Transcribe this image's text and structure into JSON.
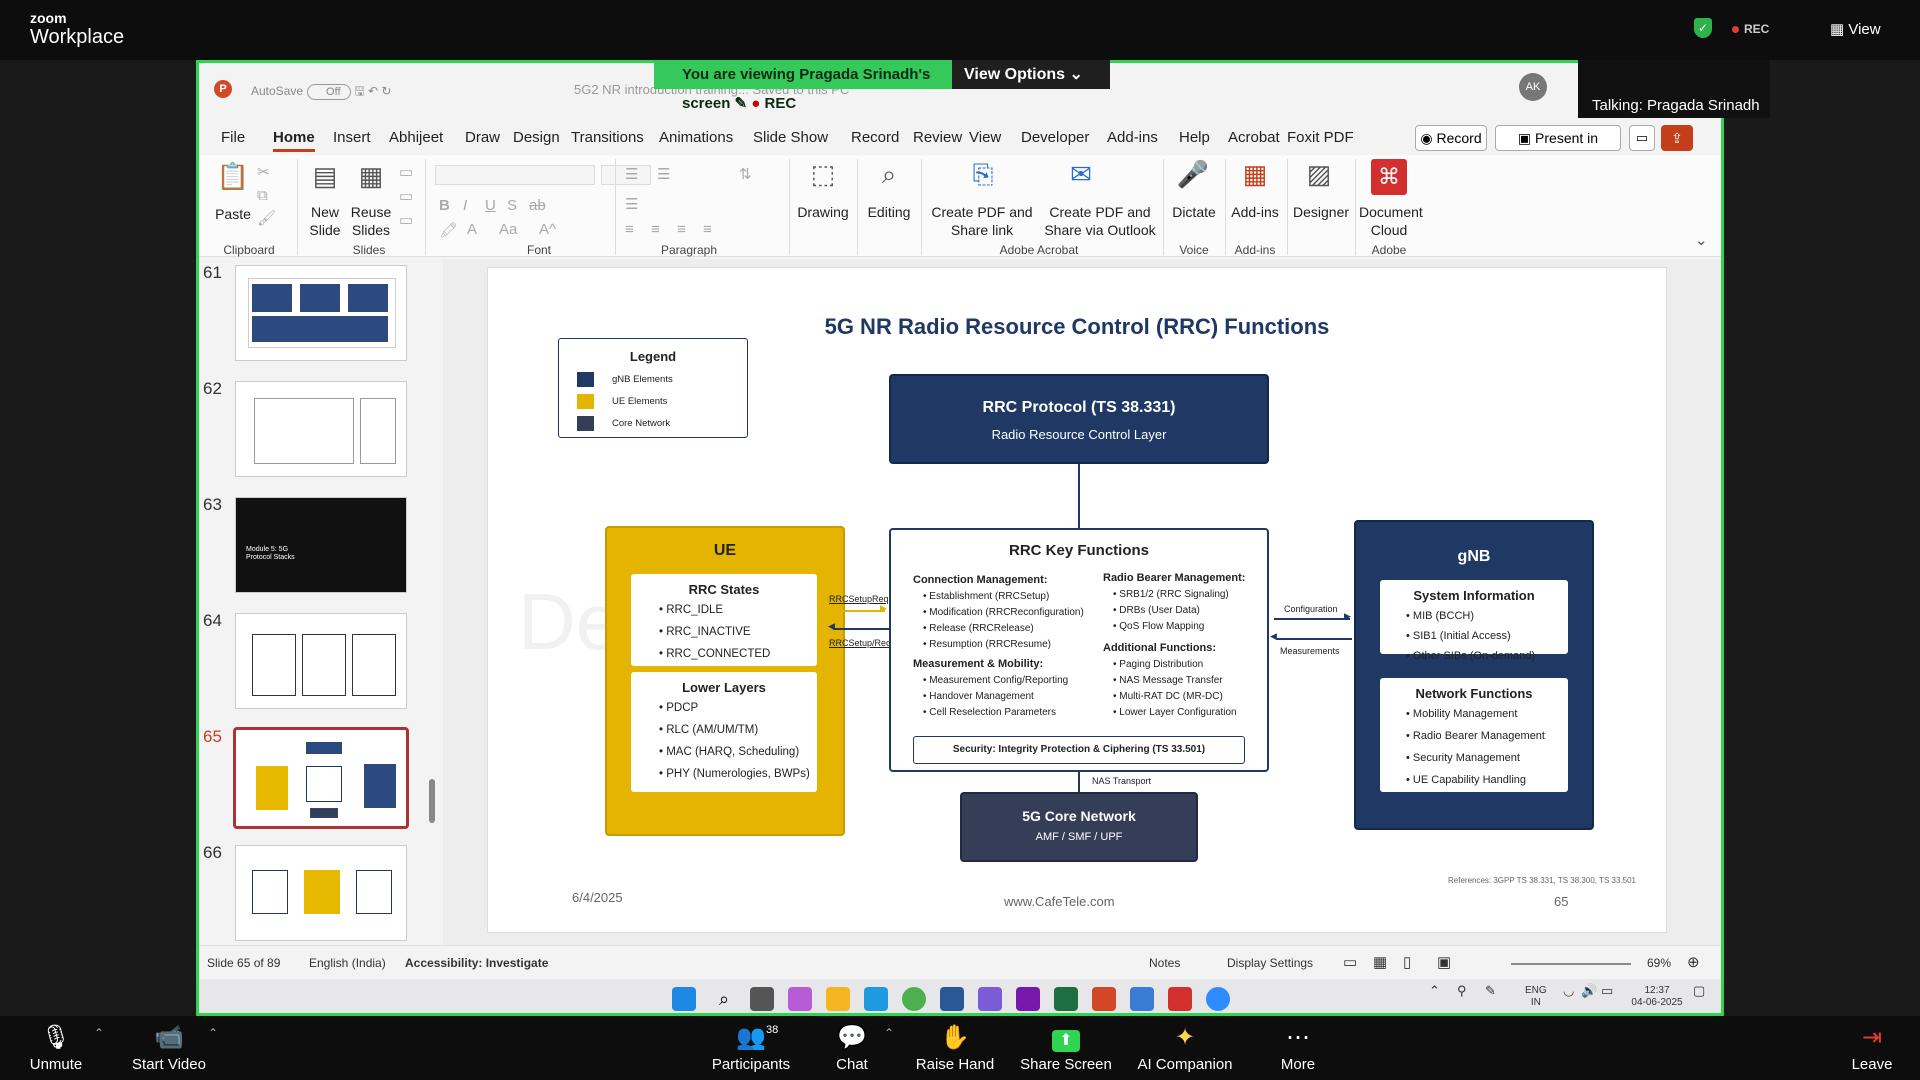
{
  "zoom": {
    "brand_small": "zoom",
    "brand": "Workplace",
    "rec": "REC",
    "view": "View",
    "banner_text": "You are viewing  Pragada Srinadh's screen",
    "banner_rec": "REC",
    "view_options": "View Options",
    "talking": "Talking: Pragada Srinadh",
    "bottom": [
      {
        "label": "Unmute",
        "icon": "mic-off-icon"
      },
      {
        "label": "Start Video",
        "icon": "video-off-icon"
      },
      {
        "label": "Participants",
        "icon": "participants-icon"
      },
      {
        "label": "Chat",
        "icon": "chat-icon"
      },
      {
        "label": "Raise Hand",
        "icon": "hand-icon"
      },
      {
        "label": "Share Screen",
        "icon": "share-icon"
      },
      {
        "label": "AI Companion",
        "icon": "sparkle-icon"
      },
      {
        "label": "More",
        "icon": "more-icon"
      },
      {
        "label": "Leave",
        "icon": "leave-icon"
      }
    ],
    "participants_count": "38"
  },
  "ppt": {
    "autosave": "AutoSave",
    "autosave_state": "Off",
    "filename": "5G2 NR introduction training...   Saved to this PC",
    "avatar": "AK",
    "menu": [
      "File",
      "Home",
      "Insert",
      "Abhijeet",
      "Draw",
      "Design",
      "Transitions",
      "Animations",
      "Slide Show",
      "Record",
      "Review",
      "View",
      "Developer",
      "Add-ins",
      "Help",
      "Acrobat",
      "Foxit PDF"
    ],
    "record_btn": "Record",
    "present_btn": "Present in Teams",
    "ribbon": {
      "paste": "Paste",
      "new_slide": "New Slide",
      "reuse_slides": "Reuse Slides",
      "drawing": "Drawing",
      "editing": "Editing",
      "create_pdf_share": "Create PDF and Share link",
      "create_pdf_outlook": "Create PDF and Share via Outlook",
      "dictate": "Dictate",
      "addins": "Add-ins",
      "designer": "Designer",
      "doc_cloud": "Document Cloud",
      "groups": {
        "clipboard": "Clipboard",
        "slides": "Slides",
        "font": "Font",
        "paragraph": "Paragraph",
        "adobe_acrobat": "Adobe Acrobat",
        "voice": "Voice",
        "addins": "Add-ins",
        "adobe": "Adobe"
      }
    },
    "thumb_numbers": [
      "61",
      "62",
      "63",
      "64",
      "65",
      "66"
    ],
    "thumb63_text": "Module 5: 5G Protocol Stacks",
    "status": {
      "slide": "Slide 65 of 89",
      "language": "English (India)",
      "accessibility": "Accessibility: Investigate",
      "notes": "Notes",
      "display": "Display Settings",
      "zoom": "69%"
    }
  },
  "slide": {
    "title": "5G NR Radio Resource Control (RRC) Functions",
    "legend": {
      "title": "Legend",
      "items": [
        {
          "label": "gNB Elements",
          "color": "#1f3864"
        },
        {
          "label": "UE Elements",
          "color": "#e5b400"
        },
        {
          "label": "Core Network",
          "color": "#343f57"
        }
      ]
    },
    "rrc_protocol": {
      "title": "RRC Protocol (TS 38.331)",
      "sub": "Radio Resource Control Layer"
    },
    "ue": {
      "title": "UE",
      "states_title": "RRC States",
      "states": [
        "• RRC_IDLE",
        "• RRC_INACTIVE",
        "• RRC_CONNECTED"
      ],
      "lower_title": "Lower Layers",
      "lower": [
        "• PDCP",
        "• RLC (AM/UM/TM)",
        "• MAC (HARQ, Scheduling)",
        "• PHY (Numerologies, BWPs)"
      ]
    },
    "key": {
      "title": "RRC Key Functions",
      "conn_title": "Connection Management:",
      "conn": [
        "• Establishment (RRCSetup)",
        "• Modification (RRCReconfiguration)",
        "• Release (RRCRelease)",
        "• Resumption (RRCResume)"
      ],
      "meas_title": "Measurement & Mobility:",
      "meas": [
        "• Measurement Config/Reporting",
        "• Handover Management",
        "• Cell Reselection Parameters"
      ],
      "rb_title": "Radio Bearer Management:",
      "rb": [
        "• SRB1/2 (RRC Signaling)",
        "• DRBs (User Data)",
        "• QoS Flow Mapping"
      ],
      "add_title": "Additional Functions:",
      "add": [
        "• Paging Distribution",
        "• NAS Message Transfer",
        "• Multi-RAT DC (MR-DC)",
        "• Lower Layer Configuration"
      ],
      "security": "Security: Integrity Protection & Ciphering (TS 33.501)"
    },
    "core": {
      "title": "5G Core Network",
      "sub": "AMF / SMF / UPF",
      "nas": "NAS Transport"
    },
    "gnb": {
      "title": "gNB",
      "sys_title": "System Information",
      "sys": [
        "• MIB (BCCH)",
        "• SIB1 (Initial Access)",
        "• Other SIBs (On-demand)"
      ],
      "net_title": "Network Functions",
      "net": [
        "• Mobility Management",
        "• Radio Bearer Management",
        "• Security Management",
        "• UE Capability Handling"
      ]
    },
    "arrows": {
      "setup_req": "RRCSetupRequest",
      "setup_reconf": "RRCSetup/Reconfig",
      "configuration": "Configuration",
      "measurements": "Measurements"
    },
    "footer": {
      "date": "6/4/2025",
      "site": "www.CafeTele.com",
      "page": "65",
      "refs": "References: 3GPP TS 38.331, TS 38.300, TS 33.501"
    }
  },
  "taskbar": {
    "lang1": "ENG",
    "lang2": "IN",
    "time": "12:37",
    "date": "04-06-2025"
  }
}
